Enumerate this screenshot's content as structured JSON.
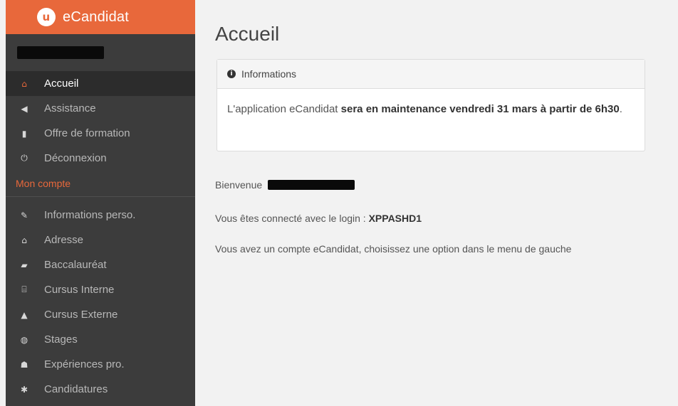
{
  "app": {
    "name": "eCandidat",
    "logo_glyph": "u",
    "accent_color": "#e8683b"
  },
  "sidebar": {
    "main_items": [
      {
        "label": "Accueil",
        "icon": "home-icon",
        "glyph": "⌂",
        "active": true
      },
      {
        "label": "Assistance",
        "icon": "bullhorn-icon",
        "glyph": "◀"
      },
      {
        "label": "Offre de formation",
        "icon": "bookmark-icon",
        "glyph": "▮"
      },
      {
        "label": "Déconnexion",
        "icon": "power-icon",
        "glyph": "⏻"
      }
    ],
    "section_title": "Mon compte",
    "account_items": [
      {
        "label": "Informations perso.",
        "icon": "pencil-icon",
        "glyph": "✎"
      },
      {
        "label": "Adresse",
        "icon": "home-icon",
        "glyph": "⌂"
      },
      {
        "label": "Baccalauréat",
        "icon": "book-icon",
        "glyph": "▰"
      },
      {
        "label": "Cursus Interne",
        "icon": "university-icon",
        "glyph": "⌸"
      },
      {
        "label": "Cursus Externe",
        "icon": "graduation-cap-icon",
        "glyph": "▲"
      },
      {
        "label": "Stages",
        "icon": "globe-icon",
        "glyph": "◍"
      },
      {
        "label": "Expériences pro.",
        "icon": "users-icon",
        "glyph": "☗"
      },
      {
        "label": "Candidatures",
        "icon": "star-icon",
        "glyph": "✱"
      }
    ]
  },
  "main": {
    "title": "Accueil",
    "panel": {
      "header": "Informations",
      "text_prefix": "L'application eCandidat ",
      "text_bold": "sera en maintenance vendredi 31 mars à partir de 6h30",
      "text_suffix": "."
    },
    "welcome_label": "Bienvenue",
    "login_label": "Vous êtes connecté avec le login : ",
    "login_value": "XPPASHD1",
    "account_message": "Vous avez un compte eCandidat, choisissez une option dans le menu de gauche"
  }
}
